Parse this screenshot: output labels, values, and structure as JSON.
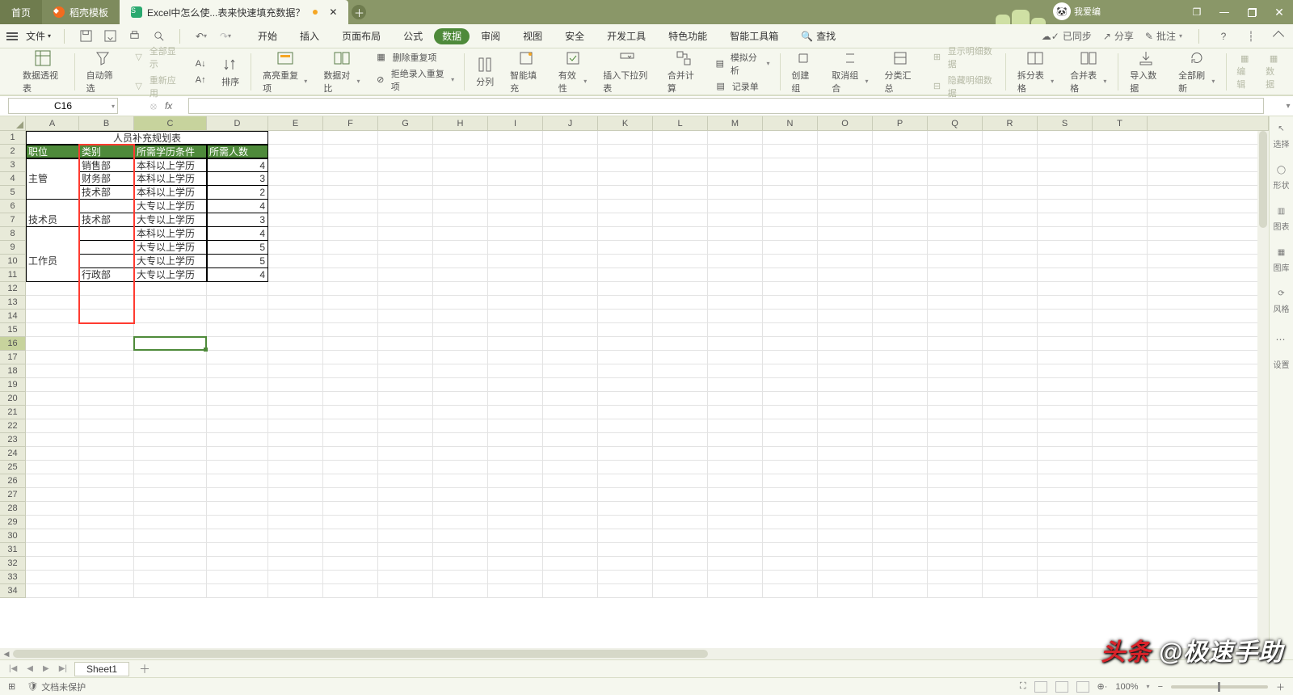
{
  "titlebar": {
    "tabs": [
      {
        "label": "首页"
      },
      {
        "label": "稻壳模板"
      },
      {
        "label": "Excel中怎么使...表来快速填充数据？"
      }
    ],
    "profile_name": "我爱编"
  },
  "menubar": {
    "file": "文件",
    "tabs": [
      "开始",
      "插入",
      "页面布局",
      "公式",
      "数据",
      "审阅",
      "视图",
      "安全",
      "开发工具",
      "特色功能",
      "智能工具箱"
    ],
    "active_index": 4,
    "search": "查找",
    "right": {
      "sync": "已同步",
      "share": "分享",
      "批注": "批注"
    }
  },
  "ribbon": {
    "items": [
      {
        "label": "数据透视表"
      },
      {
        "label": "自动筛选"
      },
      {
        "label": "全部显示"
      },
      {
        "label": "重新应用"
      },
      {
        "label": "排序"
      },
      {
        "label": "高亮重复项",
        "dd": true
      },
      {
        "label": "数据对比",
        "dd": true
      },
      {
        "label": "删除重复项"
      },
      {
        "label": "拒绝录入重复项",
        "dd": true
      },
      {
        "label": "分列"
      },
      {
        "label": "智能填充"
      },
      {
        "label": "有效性",
        "dd": true
      },
      {
        "label": "插入下拉列表"
      },
      {
        "label": "合并计算"
      },
      {
        "label": "模拟分析",
        "dd": true
      },
      {
        "label": "记录单"
      },
      {
        "label": "创建组"
      },
      {
        "label": "取消组合",
        "dd": true
      },
      {
        "label": "分类汇总"
      },
      {
        "label": "显示明细数据"
      },
      {
        "label": "隐藏明细数据"
      },
      {
        "label": "拆分表格",
        "dd": true
      },
      {
        "label": "合并表格",
        "dd": true
      },
      {
        "label": "导入数据"
      },
      {
        "label": "全部刷新",
        "dd": true
      },
      {
        "label": "编辑"
      },
      {
        "label": "数据"
      }
    ]
  },
  "fxbar": {
    "cell_ref": "C16"
  },
  "sidepanel": {
    "items": [
      {
        "label": "选择"
      },
      {
        "label": "形状"
      },
      {
        "label": "图表"
      },
      {
        "label": "图库"
      },
      {
        "label": "风格"
      },
      {
        "label": "设置"
      }
    ]
  },
  "columns": [
    "A",
    "B",
    "C",
    "D",
    "E",
    "F",
    "G",
    "H",
    "I",
    "J",
    "K",
    "L",
    "M",
    "N",
    "O",
    "P",
    "Q",
    "R",
    "S",
    "T"
  ],
  "active_col_index": 2,
  "row_count": 34,
  "active_row": 16,
  "table": {
    "title": "人员补充规划表",
    "headers": [
      "职位",
      "类别",
      "所需学历条件",
      "所需人数"
    ],
    "rows": [
      {
        "a": "",
        "b": "销售部",
        "c": "本科以上学历",
        "d": "4"
      },
      {
        "a": "",
        "b": "财务部",
        "c": "本科以上学历",
        "d": "3"
      },
      {
        "a": "主管",
        "b": "技术部",
        "c": "本科以上学历",
        "d": "2"
      },
      {
        "a": "",
        "b": "",
        "c": "大专以上学历",
        "d": "4"
      },
      {
        "a": "技术员",
        "b": "技术部",
        "c": "大专以上学历",
        "d": "3"
      },
      {
        "a": "",
        "b": "",
        "c": "本科以上学历",
        "d": "4"
      },
      {
        "a": "",
        "b": "",
        "c": "大专以上学历",
        "d": "5"
      },
      {
        "a": "工作员",
        "b": "",
        "c": "大专以上学历",
        "d": "5"
      },
      {
        "a": "",
        "b": "行政部",
        "c": "大专以上学历",
        "d": "4"
      }
    ],
    "merge_label_row": {
      "主管": 3,
      "技术员": 5,
      "工作员": 8
    }
  },
  "sheettabs": {
    "active": "Sheet1"
  },
  "statusbar": {
    "protect": "文档未保护",
    "zoom": "100%"
  },
  "watermark": {
    "t1": "头条",
    "t2": "@极速手助"
  }
}
